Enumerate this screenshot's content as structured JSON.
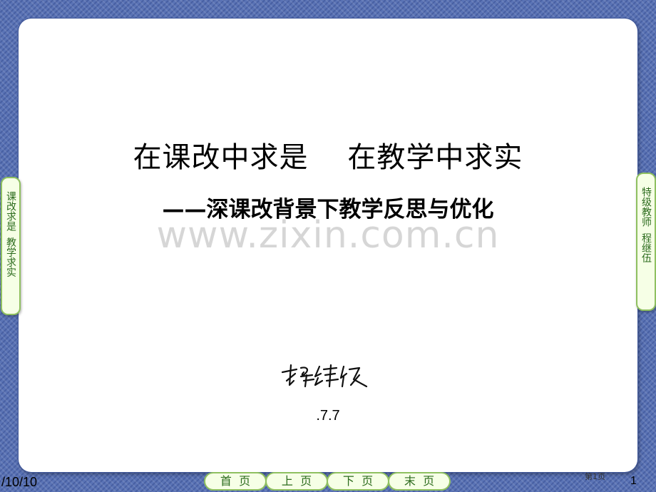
{
  "slide": {
    "title": "在课改中求是    在教学中求实",
    "subtitle": "——深课改背景下教学反思与优化",
    "watermark": "www.zixin.com.cn",
    "signature": "程继伍",
    "date": ".7.7"
  },
  "side_tabs": {
    "left": "课改求是  教学求实",
    "right": "特级教师  程继伍"
  },
  "nav": {
    "first": "首  页",
    "prev": "上  页",
    "next": "下  页",
    "last": "末  页"
  },
  "footer": {
    "date": "/10/10",
    "page_label": "第1页",
    "page_number": "1"
  },
  "colors": {
    "background": "#5a73b5",
    "nav_border": "#8fc060",
    "nav_fill": "#f6ffe6",
    "nav_text": "#2b6a1c"
  }
}
